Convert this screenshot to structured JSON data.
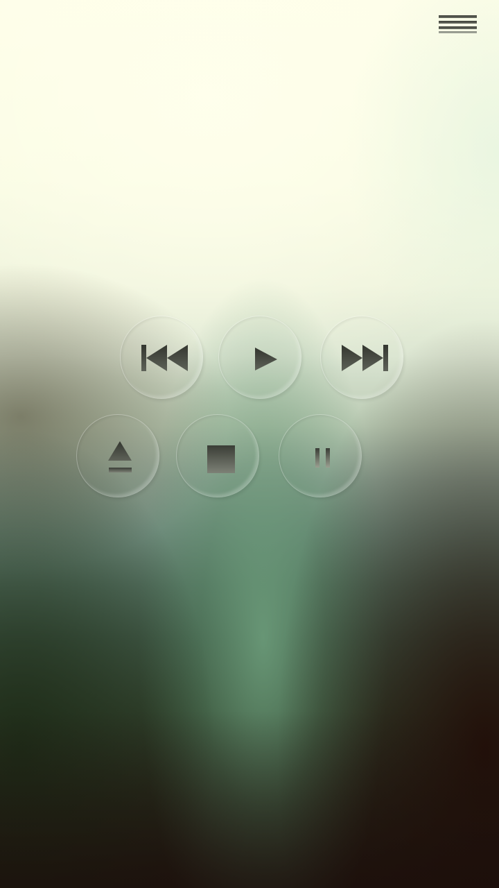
{
  "header": {
    "menu_icon": "hamburger-menu-icon"
  },
  "controls": {
    "row1": [
      {
        "id": "previous",
        "icon": "skip-previous-icon"
      },
      {
        "id": "play",
        "icon": "play-icon"
      },
      {
        "id": "next",
        "icon": "skip-next-icon"
      }
    ],
    "row2": [
      {
        "id": "eject",
        "icon": "eject-icon"
      },
      {
        "id": "stop",
        "icon": "stop-icon"
      },
      {
        "id": "pause",
        "icon": "pause-icon"
      }
    ]
  },
  "colors": {
    "icon_dark": "#3a3d36",
    "icon_light": "#7d8176",
    "background_top": "#fefee8",
    "background_mid": "#6f8b7c",
    "background_bottom": "#241812"
  }
}
